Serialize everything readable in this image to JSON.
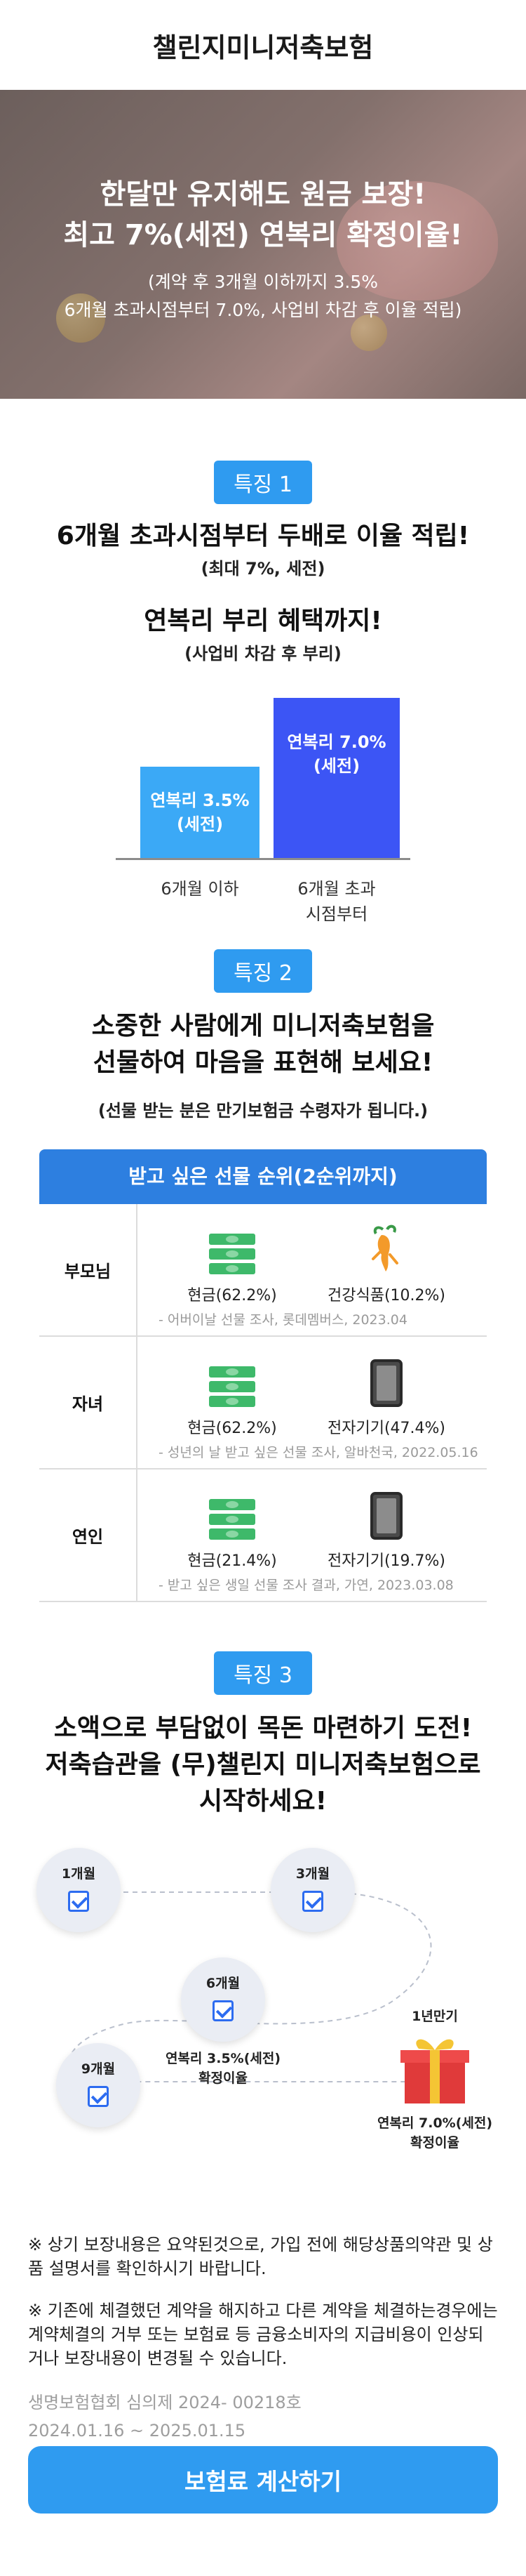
{
  "header": {
    "title": "챌린지미니저축보험"
  },
  "hero": {
    "line1": "한달만 유지해도 원금 보장!",
    "line2": "최고 7%(세전) 연복리 확정이율!",
    "sub1": "(계약 후 3개월 이하까지 3.5%",
    "sub2": "6개월 초과시점부터 7.0%, 사업비 차감 후 이율 적립)"
  },
  "feature1": {
    "badge": "특징 1",
    "title": "6개월 초과시점부터 두배로 이율 적립!",
    "note": "(최대 7%, 세전)",
    "title2": "연복리 부리 혜택까지!",
    "note2": "(사업비 차감 후 부리)"
  },
  "chart_data": {
    "type": "bar",
    "categories": [
      "6개월 이하",
      "6개월 초과 시점부터"
    ],
    "category_lines": [
      [
        "6개월 이하"
      ],
      [
        "6개월 초과",
        "시점부터"
      ]
    ],
    "series": [
      {
        "values": [
          3.5,
          7.0
        ],
        "labels": [
          [
            "연복리 3.5%",
            "(세전)"
          ],
          [
            "연복리 7.0%",
            "(세전)"
          ]
        ],
        "colors": [
          "#3ba9f6",
          "#3c55f5"
        ]
      }
    ],
    "grid": false
  },
  "feature2": {
    "badge": "특징 2",
    "title1": "소중한 사람에게 미니저축보험을",
    "title2": "선물하여 마음을 표현해 보세요!",
    "note": "(선물 받는 분은 만기보험금 수령자가 됩니다.)",
    "table_header": "받고 싶은 선물 순위(2순위까지)",
    "rows": [
      {
        "label": "부모님",
        "item1": "현금(62.2%)",
        "icon1": "money-icon",
        "item2": "건강식품(10.2%)",
        "icon2": "ginseng-icon",
        "source": "- 어버이날 선물 조사, 롯데멤버스, 2023.04"
      },
      {
        "label": "자녀",
        "item1": "현금(62.2%)",
        "icon1": "money-icon",
        "item2": "전자기기(47.4%)",
        "icon2": "tablet-icon",
        "source": "- 성년의 날 받고 싶은 선물 조사, 알바천국, 2022.05.16"
      },
      {
        "label": "연인",
        "item1": "현금(21.4%)",
        "icon1": "money-icon",
        "item2": "전자기기(19.7%)",
        "icon2": "tablet-icon",
        "source": "- 받고 싶은 생일 선물 조사 결과, 가연, 2023.03.08"
      }
    ]
  },
  "feature3": {
    "badge": "특징 3",
    "title1": "소액으로 부담없이 목돈 마련하기 도전!",
    "title2": "저축습관을 (무)챌린지 미니저축보험으로",
    "title3": "시작하세요!",
    "nodes": [
      "1개월",
      "3개월",
      "6개월",
      "9개월"
    ],
    "cap6a": "연복리 3.5%(세전)",
    "cap6b": "확정이율",
    "maturity": "1년만기",
    "capMa": "연복리 7.0%(세전)",
    "capMb": "확정이율"
  },
  "notes": {
    "n1": "※ 상기 보장내용은 요약된것으로, 가입 전에 해당상품의약관 및 상품 설명서를 확인하시기 바랍니다.",
    "n2": "※ 기존에 체결했던 계약을 해지하고 다른 계약을 체결하는경우에는 계약체결의 거부 또는 보험료 등 금융소비자의 지급비용이 인상되거나 보장내용이 변경될 수 있습니다."
  },
  "meta": {
    "review": "생명보험협회 심의제 2024- 00218호",
    "period": "2024.01.16 ~ 2025.01.15"
  },
  "cta": {
    "label": "보험료 계산하기"
  },
  "colors": {
    "accent": "#2f9bf0",
    "bar_low": "#3ba9f6",
    "bar_high": "#3c55f5",
    "table_header": "#2d7fe0"
  }
}
